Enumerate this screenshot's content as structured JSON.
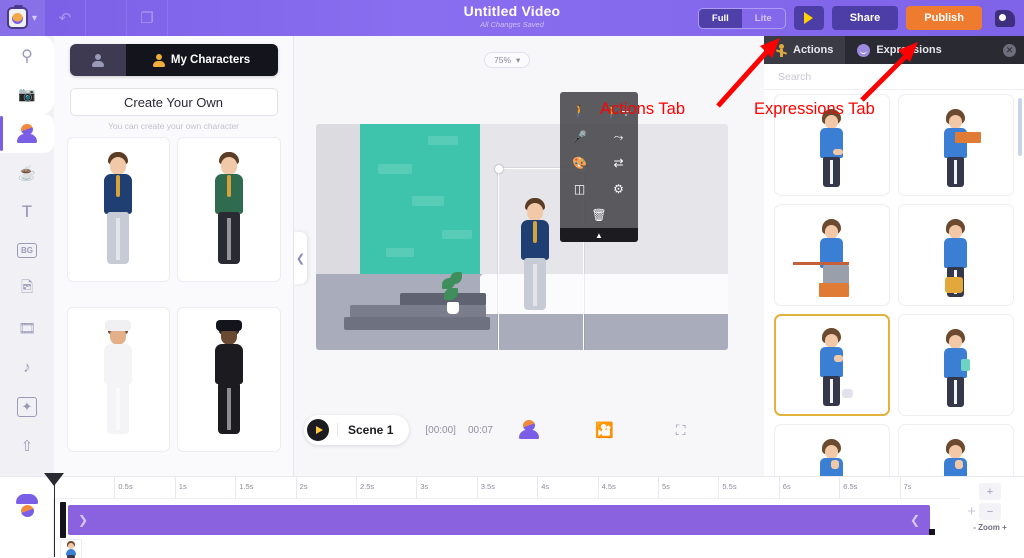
{
  "topbar": {
    "title": "Untitled Video",
    "subtitle": "All Changes Saved",
    "logo_icon": "app-logo-icon",
    "caret_icon": "chevron-down-icon",
    "undo_icon": "undo-icon",
    "copy_icon": "copy-icon",
    "mode_full": "Full",
    "mode_lite": "Lite",
    "play_icon": "play-icon",
    "share_label": "Share",
    "publish_label": "Publish",
    "avatar_icon": "user-avatar-icon"
  },
  "rail": {
    "items": [
      {
        "name": "search",
        "glyph": "⌕"
      },
      {
        "name": "video",
        "glyph": "◱"
      },
      {
        "name": "character",
        "glyph": "☻"
      },
      {
        "name": "props",
        "glyph": "☕"
      },
      {
        "name": "text",
        "glyph": "T"
      },
      {
        "name": "background",
        "glyph": "BG"
      },
      {
        "name": "image",
        "glyph": "⛰"
      },
      {
        "name": "video-clip",
        "glyph": "▷"
      },
      {
        "name": "music",
        "glyph": "♫"
      },
      {
        "name": "effects",
        "glyph": "✦"
      },
      {
        "name": "upload",
        "glyph": "⇧"
      }
    ]
  },
  "left_panel": {
    "tab_icon": "person-icon",
    "tab_label": "My Characters",
    "create_label": "Create Your Own",
    "create_hint": "You can create your own character",
    "characters": [
      {
        "label": "Man in blue blazer",
        "hair": "#5b3c26",
        "skin": "#f2c9a8",
        "body": "#1f3f73",
        "legs": "#c7cbd6",
        "hat": null
      },
      {
        "label": "Man in green blazer",
        "hair": "#5b3c26",
        "skin": "#f2c9a8",
        "body": "#2f6b4f",
        "legs": "#2a2a33",
        "hat": null
      },
      {
        "label": "Chef in white uniform",
        "hair": "#6b5340",
        "skin": "#e3b089",
        "body": "#f4f4f6",
        "legs": "#f4f4f6",
        "hat": "#f0f0f2"
      },
      {
        "label": "Man in black suit and hat",
        "hair": "#2a2a2a",
        "skin": "#6b4a33",
        "body": "#1b1b20",
        "legs": "#1b1b20",
        "hat": "#14141c"
      }
    ]
  },
  "canvas": {
    "zoom_level": "75%",
    "zoom_caret_icon": "chevron-down-icon",
    "collapse_icon": "chevron-left-icon",
    "rotate_icon": "rotate-handle-icon",
    "context_toolbar": [
      {
        "name": "walk-action-icon",
        "glyph": "Ὣ6"
      },
      {
        "name": "add-character-icon",
        "glyph": "+"
      },
      {
        "name": "microphone-icon",
        "glyph": "Ἲ4"
      },
      {
        "name": "motion-path-icon",
        "glyph": "⇝"
      },
      {
        "name": "color-palette-icon",
        "glyph": "Ἲ8"
      },
      {
        "name": "swap-character-icon",
        "glyph": "⇄"
      },
      {
        "name": "flip-icon",
        "glyph": "◧"
      },
      {
        "name": "settings-gear-icon",
        "glyph": "⚙"
      },
      {
        "name": "delete-trash-icon",
        "glyph": "Ὕ1"
      },
      {
        "name": "collapse-chevron-icon",
        "glyph": "▴"
      }
    ]
  },
  "scene_strip": {
    "play_icon": "play-icon",
    "scene_name": "Scene 1",
    "time_start": "[00:00]",
    "time_total": "00:07",
    "character_icon": "character-icon",
    "film_icon": "film-strip-icon",
    "camera_icon": "camera-focus-icon"
  },
  "right_panel": {
    "tabs": [
      {
        "label": "Actions",
        "icon": "walking-person-icon",
        "active": true
      },
      {
        "label": "Expressions",
        "icon": "smiley-face-icon",
        "active": false
      }
    ],
    "close_icon": "close-icon",
    "search_placeholder": "Search",
    "items": [
      {
        "label": "Pointing pose",
        "selected": false,
        "variant": "pointing"
      },
      {
        "label": "Holding a sign",
        "selected": false,
        "variant": "sign"
      },
      {
        "label": "Working at desk",
        "selected": false,
        "variant": "desk"
      },
      {
        "label": "Sitting on chair",
        "selected": false,
        "variant": "chair"
      },
      {
        "label": "Thinking pose",
        "selected": true,
        "variant": "thinking"
      },
      {
        "label": "Holding phone",
        "selected": false,
        "variant": "phone"
      },
      {
        "label": "Talking on phone",
        "selected": false,
        "variant": "callphone"
      },
      {
        "label": "Arms raised",
        "selected": false,
        "variant": "raised"
      }
    ]
  },
  "timeline": {
    "ticks": [
      "0.5s",
      "1s",
      "1.5s",
      "2s",
      "2.5s",
      "3s",
      "3.5s",
      "4s",
      "4.5s",
      "5s",
      "5.5s",
      "6s",
      "6.5s",
      "7s"
    ],
    "track_chevron_right_icon": "chevron-right-icon",
    "track_chevron_left_icon": "chevron-left-icon",
    "add_track_icon": "plus-icon",
    "zoom_in_icon": "plus-icon",
    "zoom_out_icon": "minus-icon",
    "zoom_label": "-  Zoom  +",
    "character_icon": "character-avatar-icon",
    "layer_thumb": "character-thumbnail"
  },
  "annotations": [
    {
      "text": "Actions Tab",
      "color": "#ff0000"
    },
    {
      "text": "Expressions Tab",
      "color": "#ff0000"
    }
  ]
}
